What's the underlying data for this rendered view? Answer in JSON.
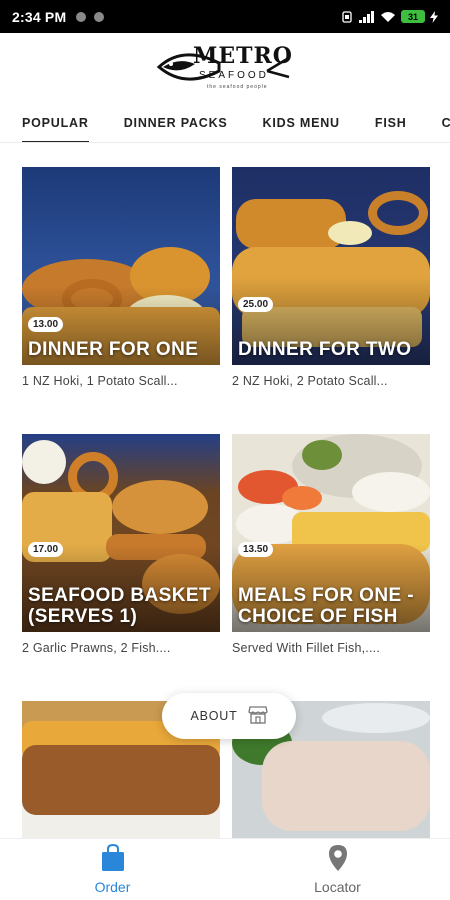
{
  "status_bar": {
    "time": "2:34 PM",
    "battery": "31",
    "icons": [
      "notification-dot-icon",
      "notification-dot-icon",
      "vibrate-icon",
      "signal-icon",
      "wifi-icon",
      "battery-icon",
      "charging-icon"
    ]
  },
  "header": {
    "logo_text": "METRO",
    "logo_sub": "SEAFOOD",
    "logo_tagline": "the seafood people"
  },
  "tabs": [
    {
      "label": "POPULAR",
      "active": true
    },
    {
      "label": "DINNER PACKS",
      "active": false
    },
    {
      "label": "KIDS MENU",
      "active": false
    },
    {
      "label": "FISH",
      "active": false
    },
    {
      "label": "CH",
      "active": false
    }
  ],
  "items": [
    {
      "price": "13.00",
      "title": "DINNER FOR ONE",
      "description": "1 NZ Hoki, 1 Potato Scall..."
    },
    {
      "price": "25.00",
      "title": "DINNER FOR TWO",
      "description": "2 NZ Hoki, 2 Potato Scall..."
    },
    {
      "price": "17.00",
      "title": "SEAFOOD BASKET (SERVES 1)",
      "description": "2 Garlic Prawns, 2 Fish...."
    },
    {
      "price": "13.50",
      "title": "MEALS FOR ONE - CHOICE OF FISH",
      "description": "Served With Fillet Fish,...."
    },
    {
      "price": "",
      "title": "",
      "description": ""
    },
    {
      "price": "",
      "title": "",
      "description": ""
    }
  ],
  "about_button": {
    "label": "ABOUT",
    "icon": "store-icon"
  },
  "bottom_nav": [
    {
      "label": "Order",
      "icon": "shopping-bag-icon",
      "active": true,
      "color": "#2a86d9"
    },
    {
      "label": "Locator",
      "icon": "location-pin-icon",
      "active": false,
      "color": "#666666"
    }
  ]
}
